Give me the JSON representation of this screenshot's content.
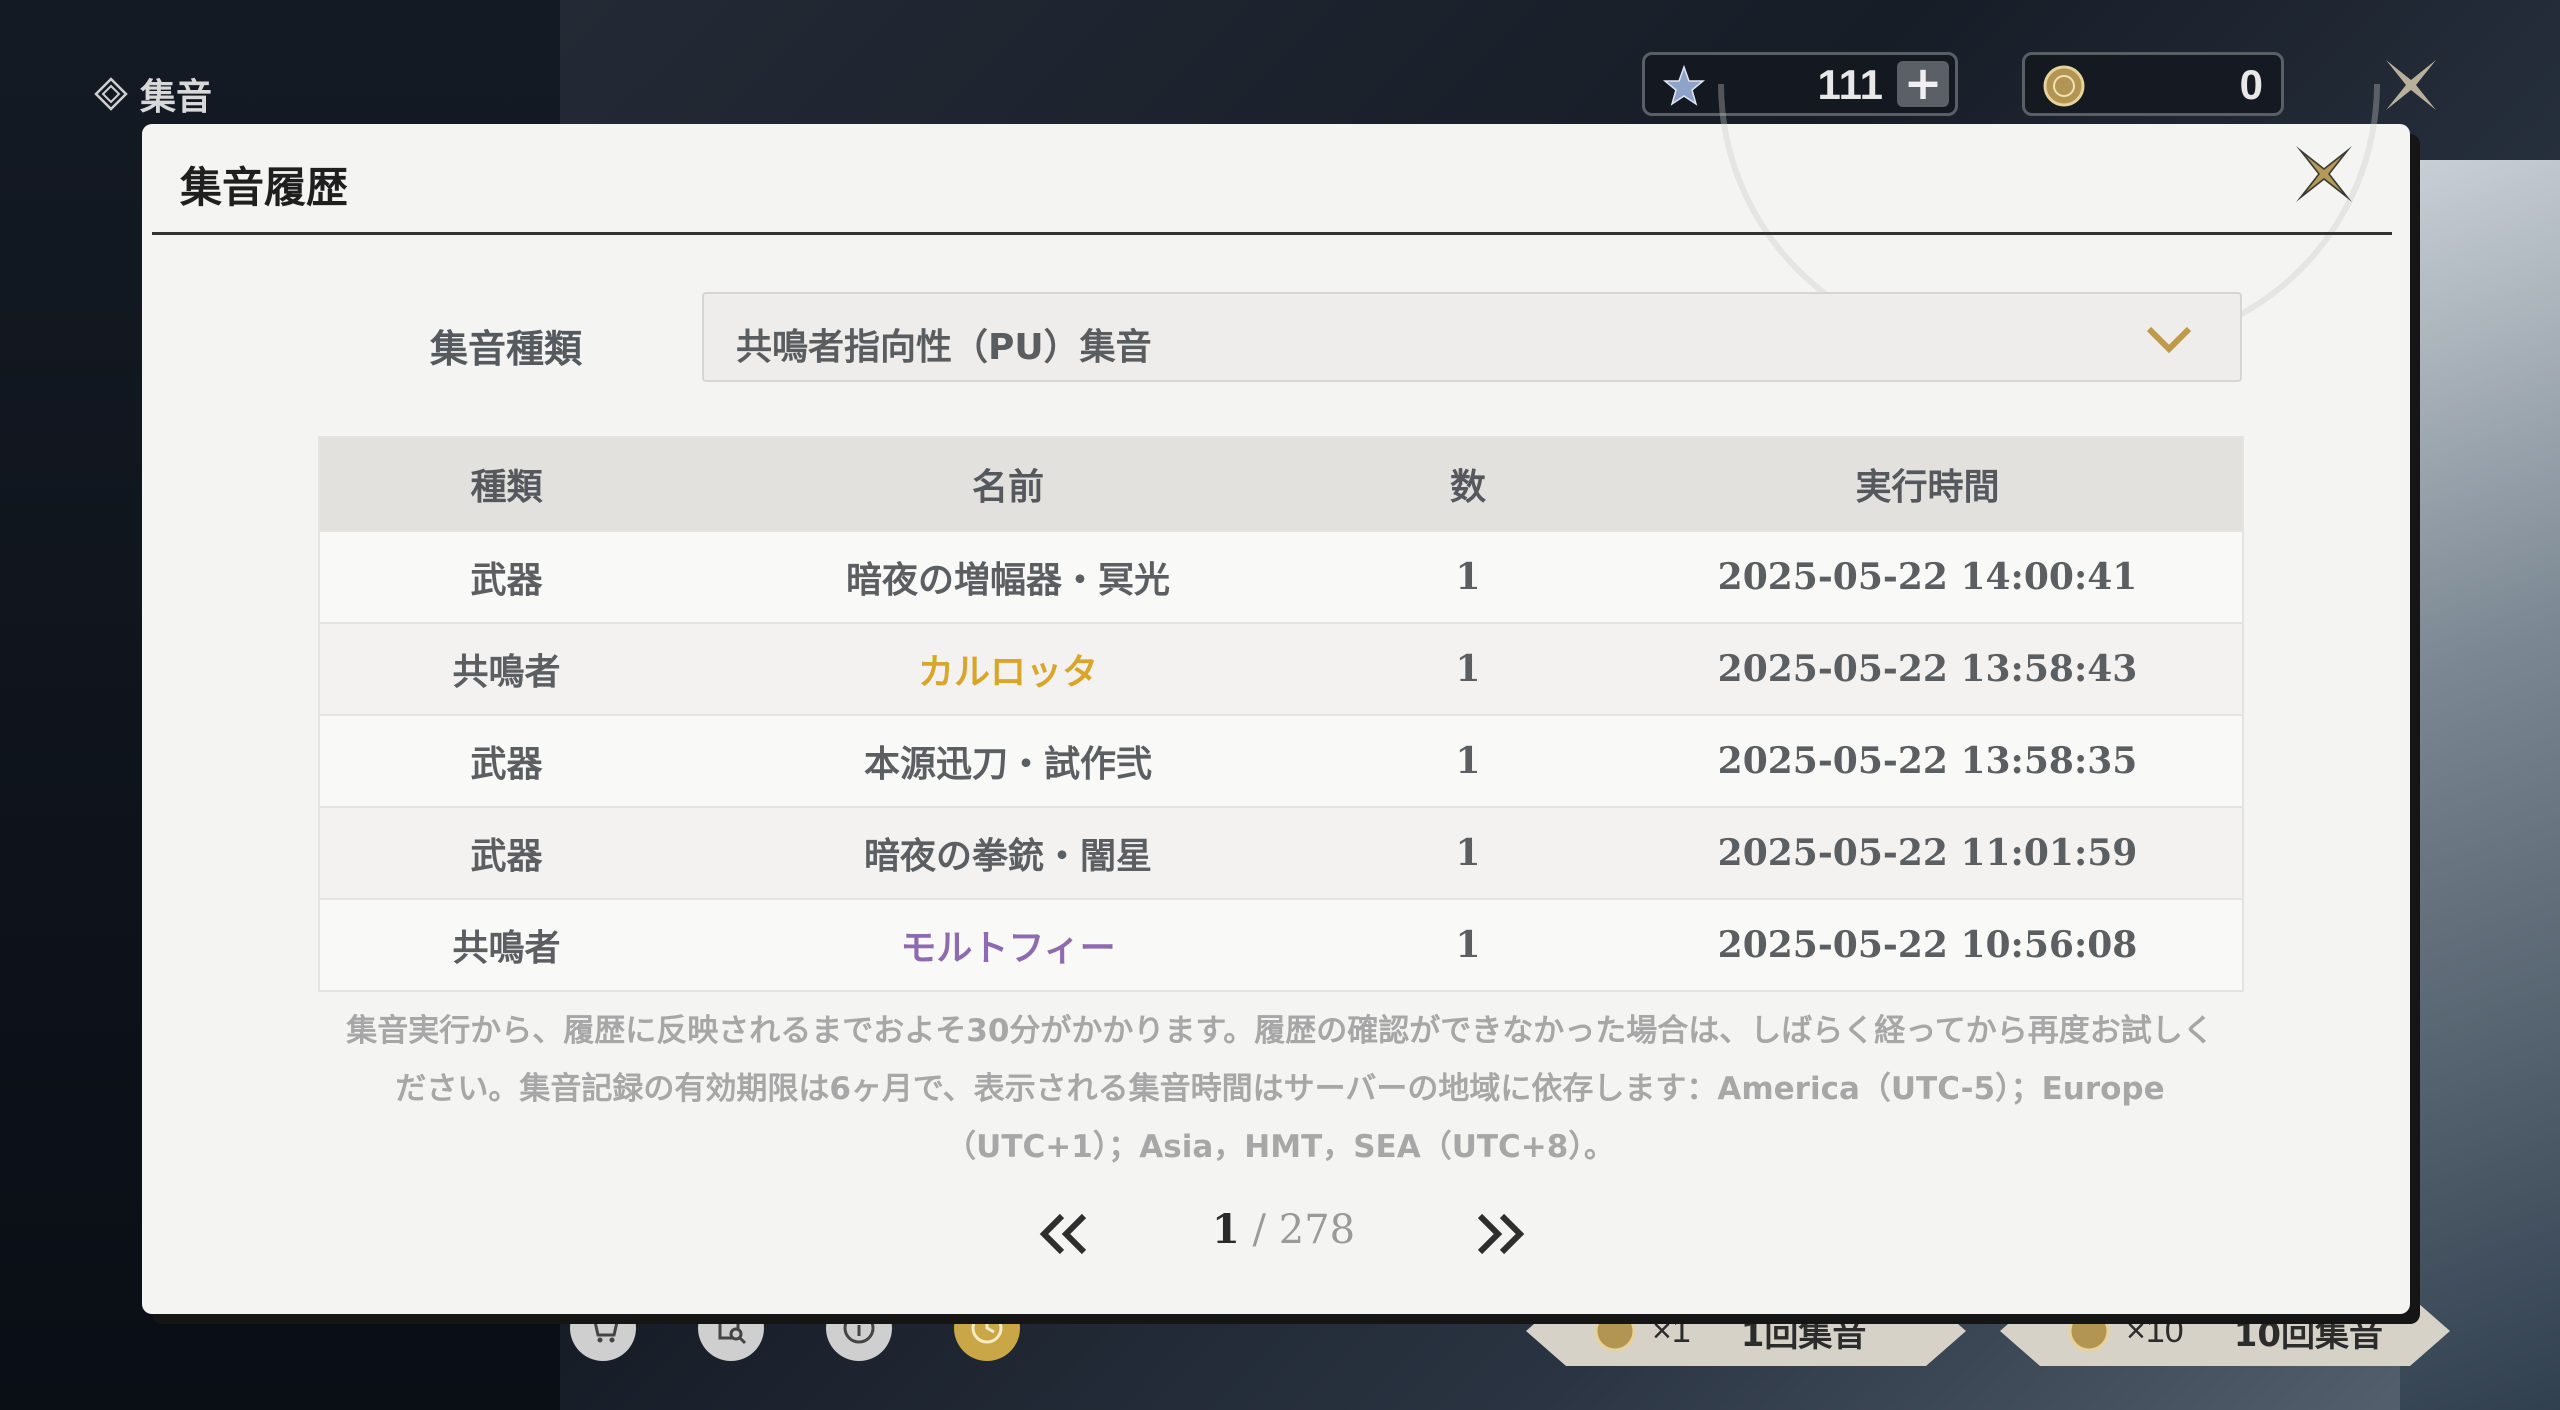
{
  "screen": {
    "title": "集音",
    "currencies": [
      {
        "icon": "star-crystal-icon",
        "value": "111"
      },
      {
        "icon": "gold-coin-icon",
        "value": "0"
      }
    ],
    "bottom_buttons": [
      {
        "icon": "cart-icon"
      },
      {
        "icon": "search-document-icon"
      },
      {
        "icon": "info-icon"
      },
      {
        "icon": "clock-icon"
      }
    ],
    "pull_single": {
      "multiplier": "×1",
      "label": "1回集音"
    },
    "pull_ten": {
      "multiplier": "×10",
      "label": "10回集音"
    }
  },
  "modal": {
    "title": "集音履歴",
    "filter_label": "集音種類",
    "filter_value": "共鳴者指向性（PU）集音",
    "columns": [
      "種類",
      "名前",
      "数",
      "実行時間"
    ],
    "rows": [
      {
        "type": "武器",
        "name": "暗夜の増幅器・冥光",
        "count": "1",
        "time": "2025-05-22 14:00:41"
      },
      {
        "type": "共鳴者",
        "name": "カルロッタ",
        "count": "1",
        "time": "2025-05-22 13:58:43"
      },
      {
        "type": "武器",
        "name": "本源迅刀・試作弐",
        "count": "1",
        "time": "2025-05-22 13:58:35"
      },
      {
        "type": "武器",
        "name": "暗夜の拳銃・闇星",
        "count": "1",
        "time": "2025-05-22 11:01:59"
      },
      {
        "type": "共鳴者",
        "name": "モルトフィー",
        "count": "1",
        "time": "2025-05-22 10:56:08"
      }
    ],
    "notice_lines": [
      "集音実行から、履歴に反映されるまでおよそ30分がかかります。履歴の確認ができなかった場合は、しばらく経ってから再度お試しく",
      "ださい。集音記録の有効期限は6ヶ月で、表示される集音時間はサーバーの地域に依存します：America（UTC-5）；Europe",
      "（UTC+1）；Asia，HMT，SEA（UTC+8）。"
    ],
    "pager": {
      "current": "1",
      "separator": " / ",
      "total": "278"
    }
  },
  "colors": {
    "gold_name": "#d9a62c",
    "purple_name": "#8e6bb0",
    "accent_gold": "#bf9a4a",
    "modal_bg": "#f4f4f3"
  }
}
